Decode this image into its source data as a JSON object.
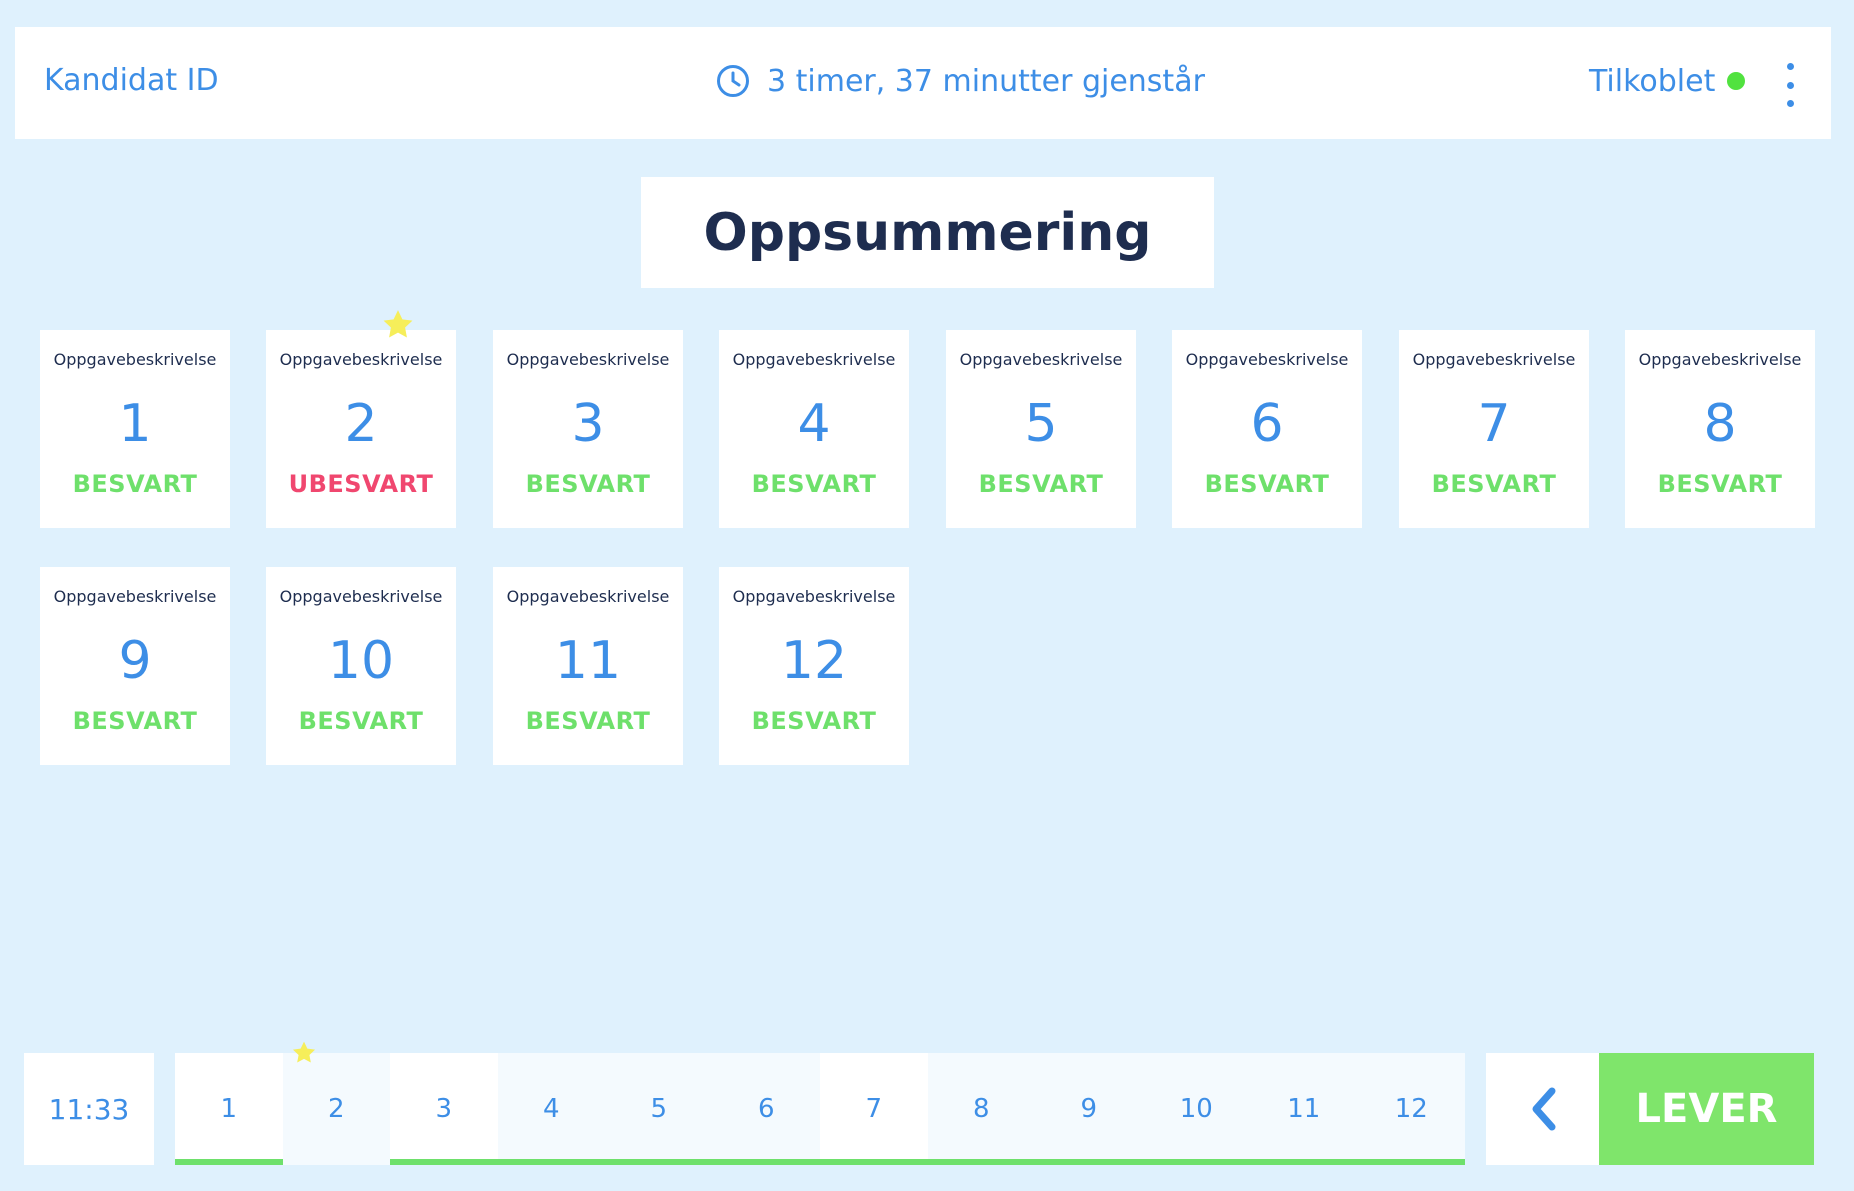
{
  "header": {
    "candidate_label": "Kandidat ID",
    "time_remaining": "3 timer,  37 minutter gjenstår",
    "connection_label": "Tilkoblet",
    "connection_color": "#51e23f"
  },
  "page_title": "Oppsummering",
  "tasks": [
    {
      "desc": "Oppgavebeskrivelse",
      "num": "1",
      "status": "BESVART",
      "answered": true,
      "starred": false
    },
    {
      "desc": "Oppgavebeskrivelse",
      "num": "2",
      "status": "UBESVART",
      "answered": false,
      "starred": true
    },
    {
      "desc": "Oppgavebeskrivelse",
      "num": "3",
      "status": "BESVART",
      "answered": true,
      "starred": false
    },
    {
      "desc": "Oppgavebeskrivelse",
      "num": "4",
      "status": "BESVART",
      "answered": true,
      "starred": false
    },
    {
      "desc": "Oppgavebeskrivelse",
      "num": "5",
      "status": "BESVART",
      "answered": true,
      "starred": false
    },
    {
      "desc": "Oppgavebeskrivelse",
      "num": "6",
      "status": "BESVART",
      "answered": true,
      "starred": false
    },
    {
      "desc": "Oppgavebeskrivelse",
      "num": "7",
      "status": "BESVART",
      "answered": true,
      "starred": false
    },
    {
      "desc": "Oppgavebeskrivelse",
      "num": "8",
      "status": "BESVART",
      "answered": true,
      "starred": false
    },
    {
      "desc": "Oppgavebeskrivelse",
      "num": "9",
      "status": "BESVART",
      "answered": true,
      "starred": false
    },
    {
      "desc": "Oppgavebeskrivelse",
      "num": "10",
      "status": "BESVART",
      "answered": true,
      "starred": false
    },
    {
      "desc": "Oppgavebeskrivelse",
      "num": "11",
      "status": "BESVART",
      "answered": true,
      "starred": false
    },
    {
      "desc": "Oppgavebeskrivelse",
      "num": "12",
      "status": "BESVART",
      "answered": true,
      "starred": false
    }
  ],
  "footer": {
    "clock": "11:33",
    "nav_items": [
      "1",
      "2",
      "3",
      "4",
      "5",
      "6",
      "7",
      "8",
      "9",
      "10",
      "11",
      "12"
    ],
    "submit_label": "LEVER"
  },
  "colors": {
    "background": "#dff1fd",
    "accent": "#3d8ee6",
    "answered": "#6ee06b",
    "unanswered": "#f0476f",
    "star": "#f6ee5a",
    "submit": "#7fe56b"
  }
}
